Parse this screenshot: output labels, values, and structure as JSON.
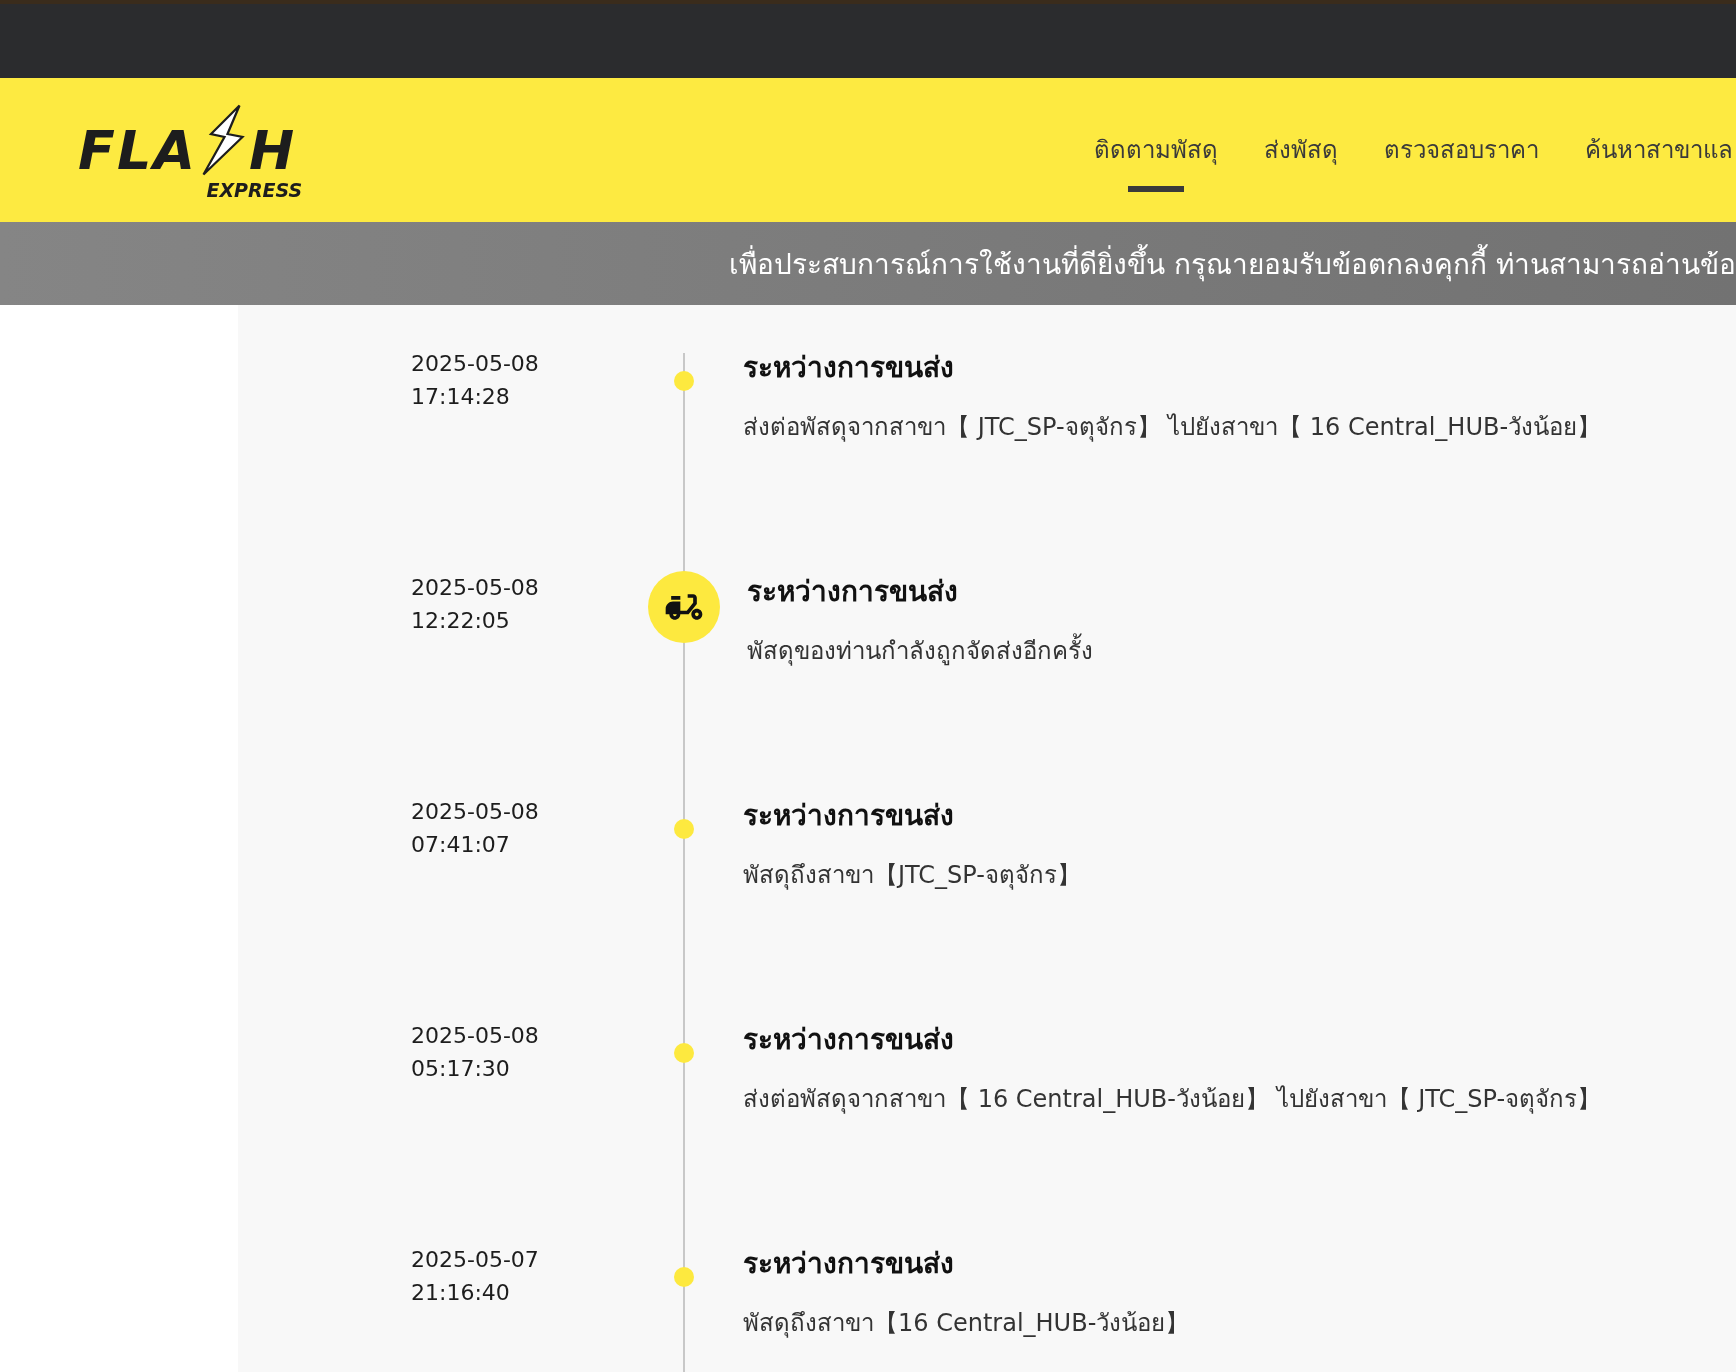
{
  "logo": {
    "left": "FLA",
    "right": "H",
    "tagline": "EXPRESS"
  },
  "nav": [
    {
      "label": "ติดตามพัสดุ",
      "selected": true
    },
    {
      "label": "ส่งพัสดุ",
      "selected": false
    },
    {
      "label": "ตรวจสอบราคา",
      "selected": false
    },
    {
      "label": "ค้นหาสาขาแล",
      "selected": false
    }
  ],
  "cookie_banner": {
    "text": "เพื่อประสบการณ์การใช้งานที่ดียิ่งขึ้น กรุณายอมรับข้อตกลงคุกกี้ ท่านสามารถอ่านข้อ"
  },
  "timeline": [
    {
      "date": "2025-05-08",
      "time": "17:14:28",
      "kind": "dot",
      "status": "ระหว่างการขนส่ง",
      "detail": "ส่งต่อพัสดุจากสาขา【 JTC_SP-จตุจักร】 ไปยังสาขา【 16 Central_HUB-วังน้อย】"
    },
    {
      "date": "2025-05-08",
      "time": "12:22:05",
      "kind": "scooter",
      "status": "ระหว่างการขนส่ง",
      "detail": "พัสดุของท่านกำลังถูกจัดส่งอีกครั้ง"
    },
    {
      "date": "2025-05-08",
      "time": "07:41:07",
      "kind": "dot",
      "status": "ระหว่างการขนส่ง",
      "detail": "พัสดุถึงสาขา【JTC_SP-จตุจักร】"
    },
    {
      "date": "2025-05-08",
      "time": "05:17:30",
      "kind": "dot",
      "status": "ระหว่างการขนส่ง",
      "detail": "ส่งต่อพัสดุจากสาขา【 16 Central_HUB-วังน้อย】 ไปยังสาขา【 JTC_SP-จตุจักร】"
    },
    {
      "date": "2025-05-07",
      "time": "21:16:40",
      "kind": "dot",
      "status": "ระหว่างการขนส่ง",
      "detail": "พัสดุถึงสาขา【16 Central_HUB-วังน้อย】"
    }
  ]
}
